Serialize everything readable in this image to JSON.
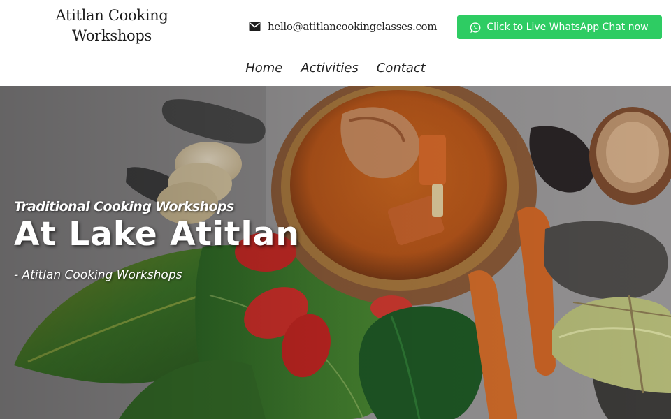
{
  "header": {
    "logo_line1": "Atitlan Cooking",
    "logo_line2": "Workshops",
    "email": "hello@atitlancookingclasses.com",
    "whatsapp_label": "Click to Live WhatsApp Chat now"
  },
  "nav": {
    "items": [
      {
        "label": "Home"
      },
      {
        "label": "Activities"
      },
      {
        "label": "Contact"
      }
    ]
  },
  "hero": {
    "subtitle": "Traditional Cooking Workshops",
    "title": "At Lake Atitlan",
    "tagline": "- Atitlan Cooking Workshops"
  },
  "colors": {
    "whatsapp_green": "#2ecc63",
    "text_dark": "#222222",
    "hero_text": "#ffffff"
  },
  "icons": {
    "email": "envelope-icon",
    "whatsapp": "whatsapp-icon"
  }
}
